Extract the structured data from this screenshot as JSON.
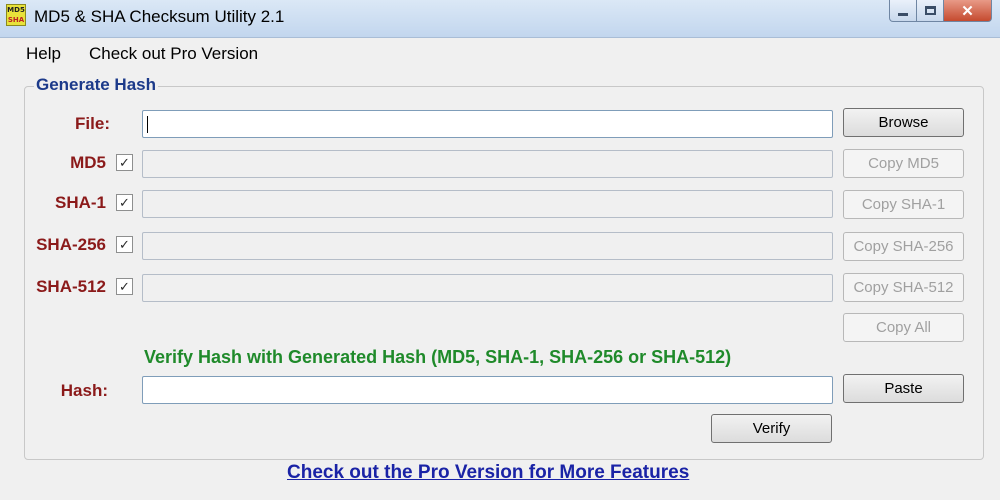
{
  "window": {
    "title": "MD5 & SHA Checksum Utility 2.1",
    "icon_text_line1": "MD5",
    "icon_text_line2": "SHA",
    "close_glyph": "✕"
  },
  "menu": {
    "items": [
      {
        "label": "Help"
      },
      {
        "label": "Check out Pro Version"
      }
    ]
  },
  "generate": {
    "group_title": "Generate Hash",
    "file_label": "File:",
    "file_value": "",
    "browse_label": "Browse",
    "rows": [
      {
        "label": "MD5",
        "checked": true,
        "check_glyph": "✓",
        "value": "",
        "copy_label": "Copy MD5"
      },
      {
        "label": "SHA-1",
        "checked": true,
        "check_glyph": "✓",
        "value": "",
        "copy_label": "Copy SHA-1"
      },
      {
        "label": "SHA-256",
        "checked": true,
        "check_glyph": "✓",
        "value": "",
        "copy_label": "Copy SHA-256"
      },
      {
        "label": "SHA-512",
        "checked": true,
        "check_glyph": "✓",
        "value": "",
        "copy_label": "Copy SHA-512"
      }
    ],
    "copy_all_label": "Copy All"
  },
  "verify": {
    "title": "Verify Hash with Generated Hash (MD5, SHA-1, SHA-256 or SHA-512)",
    "hash_label": "Hash:",
    "hash_value": "",
    "paste_label": "Paste",
    "verify_label": "Verify"
  },
  "footer": {
    "pro_link": "Check out the Pro Version for More Features"
  },
  "colors": {
    "label_red": "#8b1a1a",
    "group_title_blue": "#1c3a8a",
    "verify_green": "#1f8a2a",
    "link_blue": "#1a23a6"
  }
}
